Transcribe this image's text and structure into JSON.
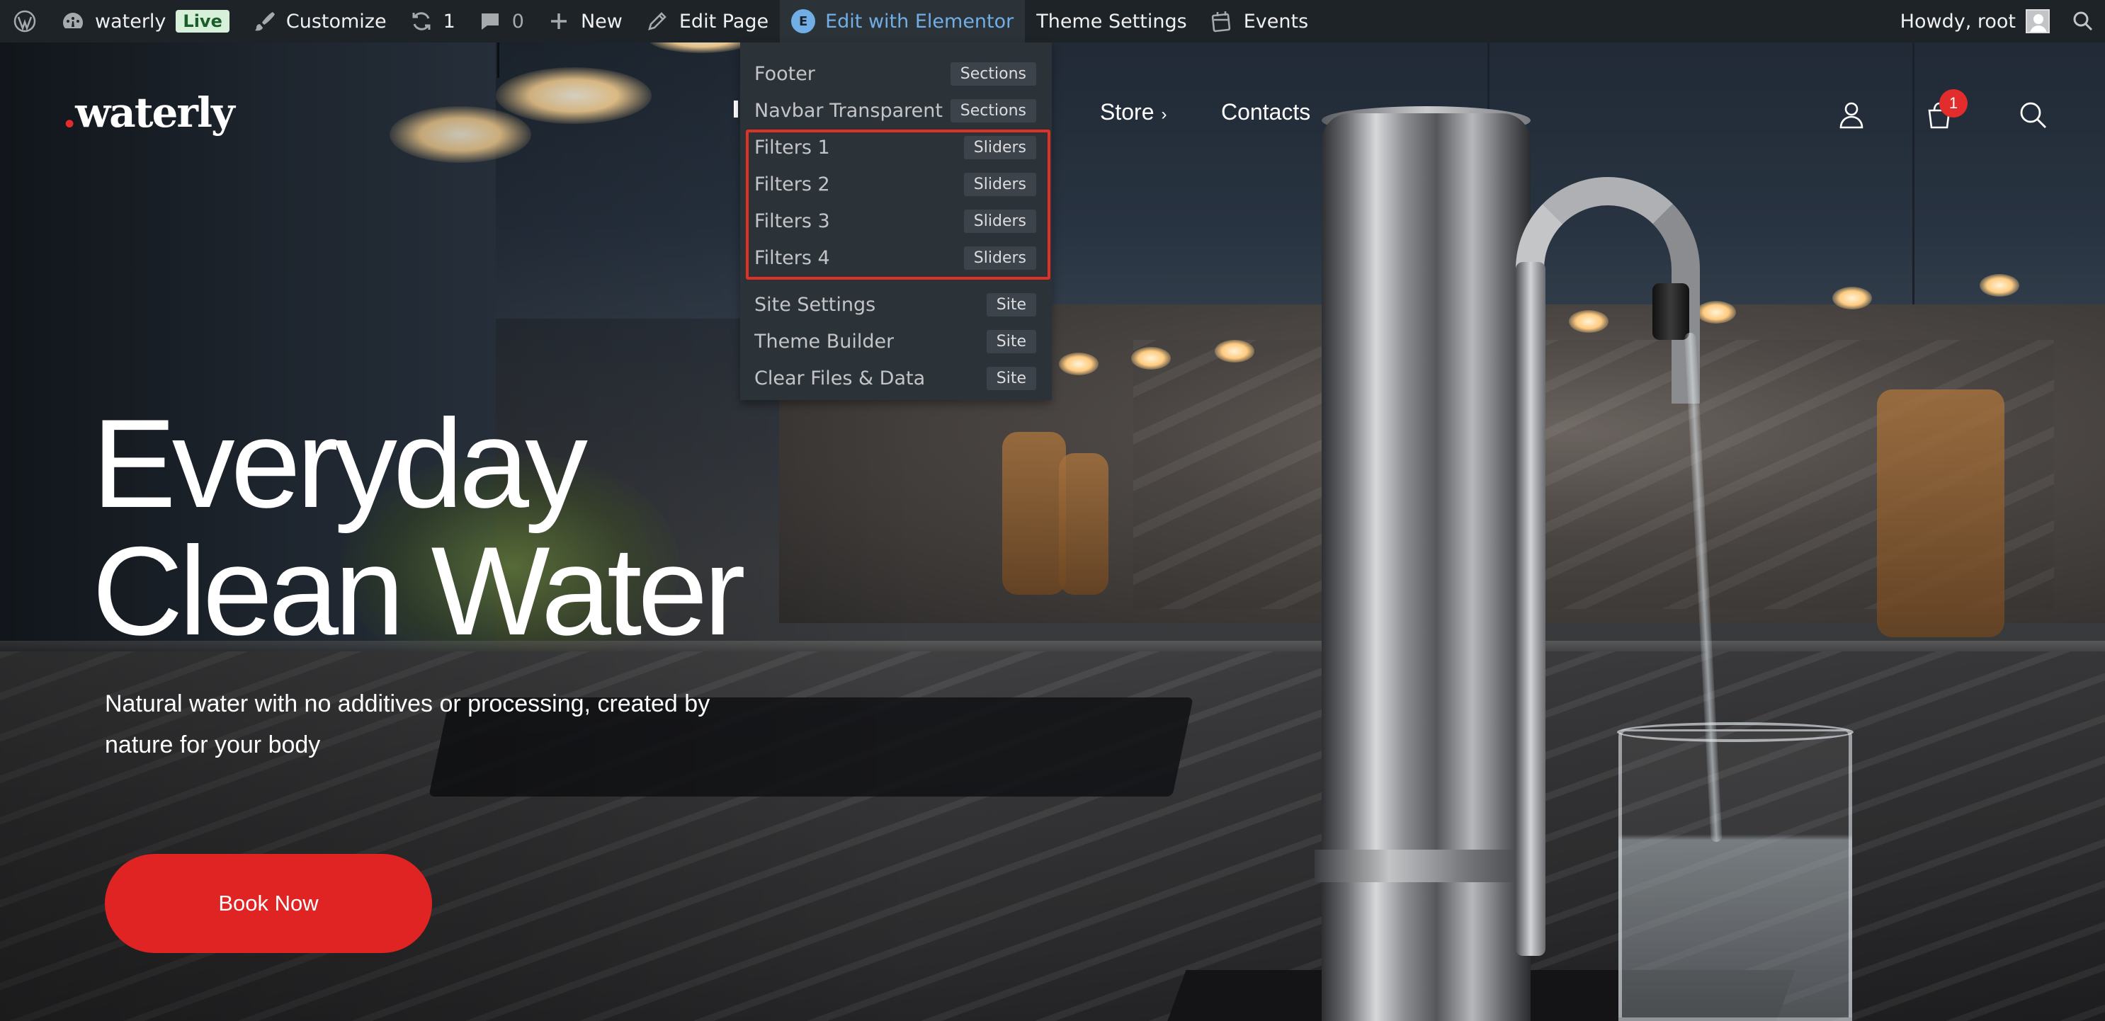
{
  "admin_bar": {
    "site_name": "waterly",
    "live_badge": "Live",
    "customize": "Customize",
    "updates_count": "1",
    "comments_count": "0",
    "new": "New",
    "edit_page": "Edit Page",
    "edit_with_elementor": "Edit with Elementor",
    "theme_settings": "Theme Settings",
    "events": "Events",
    "howdy": "Howdy, root"
  },
  "elementor_menu": {
    "items": [
      {
        "label": "Footer",
        "tag": "Sections"
      },
      {
        "label": "Navbar Transparent ...",
        "tag": "Sections"
      },
      {
        "label": "Filters 1",
        "tag": "Sliders"
      },
      {
        "label": "Filters 2",
        "tag": "Sliders"
      },
      {
        "label": "Filters 3",
        "tag": "Sliders"
      },
      {
        "label": "Filters 4",
        "tag": "Sliders"
      },
      {
        "label": "Site Settings",
        "tag": "Site"
      },
      {
        "label": "Theme Builder",
        "tag": "Site"
      },
      {
        "label": "Clear Files & Data",
        "tag": "Site"
      }
    ]
  },
  "site_header": {
    "logo_dot": ".",
    "logo_text": "waterly",
    "nav": [
      {
        "label": "Store",
        "chevron": "›"
      },
      {
        "label": "Contacts"
      }
    ],
    "cart_count": "1",
    "icons": [
      "user-icon",
      "cart-icon",
      "search-icon"
    ]
  },
  "hero": {
    "title_line1": "Everyday",
    "title_line2": "Clean Water",
    "subtitle": "Natural water with no additives or processing, created by nature for your body",
    "cta": "Book Now"
  },
  "colors": {
    "admin_bar_bg": "#1d2327",
    "dropdown_bg": "#2c3338",
    "accent_red": "#e02424",
    "highlight_border": "#e03127",
    "elementor_blue": "#72aee6"
  }
}
